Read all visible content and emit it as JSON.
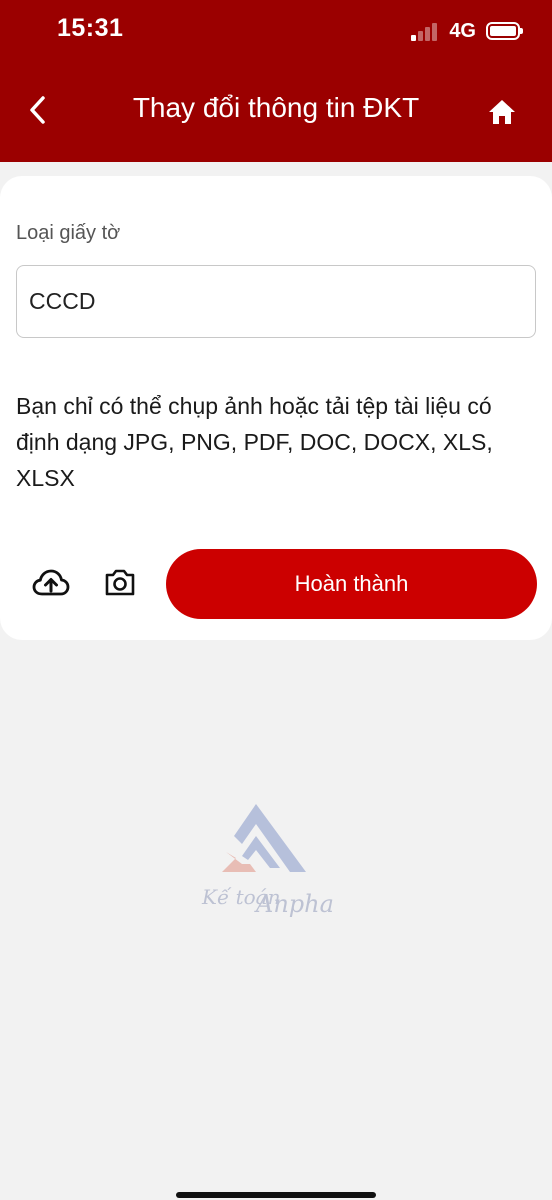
{
  "status_bar": {
    "time": "15:31",
    "network": "4G",
    "icons": [
      "signal-icon",
      "battery-icon"
    ]
  },
  "header": {
    "title": "Thay đổi thông tin ĐKT",
    "back_icon": "chevron-left-icon",
    "home_icon": "home-icon",
    "background_color": "#9b0000"
  },
  "form": {
    "document_type_label": "Loại giấy tờ",
    "document_type_value": "CCCD",
    "info_text": "Bạn chỉ có thể chụp ảnh hoặc tải tệp tài liệu có định dạng JPG, PNG, PDF, DOC, DOCX, XLS, XLSX",
    "upload_icon": "cloud-upload-icon",
    "camera_icon": "camera-icon",
    "submit_label": "Hoàn thành",
    "submit_color": "#cc0000"
  },
  "watermark": {
    "text": "Kế toán Anpha"
  }
}
